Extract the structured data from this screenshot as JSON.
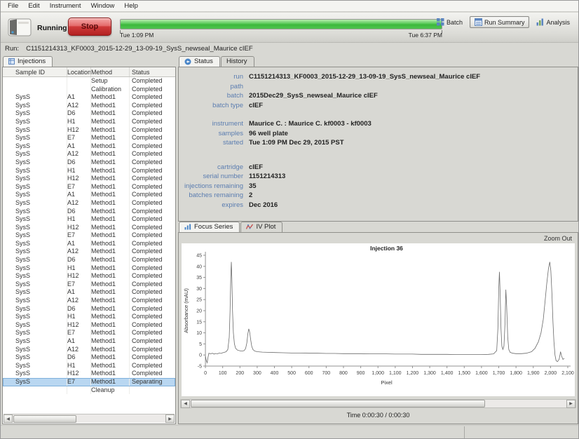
{
  "menu": {
    "items": [
      "File",
      "Edit",
      "Instrument",
      "Window",
      "Help"
    ]
  },
  "toolbar": {
    "status": "Running",
    "stop_label": "Stop",
    "progress_percent": 100,
    "progress_start": "Tue 1:09 PM",
    "progress_end": "Tue 6:37 PM",
    "buttons": [
      {
        "label": "Batch"
      },
      {
        "label": "Run Summary",
        "selected": true
      },
      {
        "label": "Analysis"
      }
    ]
  },
  "run_bar": {
    "prefix": "Run:",
    "value": "C1151214313_KF0003_2015-12-29_13-09-19_SysS_newseal_Maurice cIEF"
  },
  "injections_panel": {
    "tab_label": "Injections",
    "columns": [
      "Sample ID",
      "Location",
      "Method",
      "Status"
    ],
    "rows": [
      {
        "sample": "",
        "location": "",
        "method": "Setup",
        "status": "Completed"
      },
      {
        "sample": "",
        "location": "",
        "method": "Calibration",
        "status": "Completed"
      },
      {
        "sample": "SysS",
        "location": "A1",
        "method": "Method1",
        "status": "Completed"
      },
      {
        "sample": "SysS",
        "location": "A12",
        "method": "Method1",
        "status": "Completed"
      },
      {
        "sample": "SysS",
        "location": "D6",
        "method": "Method1",
        "status": "Completed"
      },
      {
        "sample": "SysS",
        "location": "H1",
        "method": "Method1",
        "status": "Completed"
      },
      {
        "sample": "SysS",
        "location": "H12",
        "method": "Method1",
        "status": "Completed"
      },
      {
        "sample": "SysS",
        "location": "E7",
        "method": "Method1",
        "status": "Completed"
      },
      {
        "sample": "SysS",
        "location": "A1",
        "method": "Method1",
        "status": "Completed"
      },
      {
        "sample": "SysS",
        "location": "A12",
        "method": "Method1",
        "status": "Completed"
      },
      {
        "sample": "SysS",
        "location": "D6",
        "method": "Method1",
        "status": "Completed"
      },
      {
        "sample": "SysS",
        "location": "H1",
        "method": "Method1",
        "status": "Completed"
      },
      {
        "sample": "SysS",
        "location": "H12",
        "method": "Method1",
        "status": "Completed"
      },
      {
        "sample": "SysS",
        "location": "E7",
        "method": "Method1",
        "status": "Completed"
      },
      {
        "sample": "SysS",
        "location": "A1",
        "method": "Method1",
        "status": "Completed"
      },
      {
        "sample": "SysS",
        "location": "A12",
        "method": "Method1",
        "status": "Completed"
      },
      {
        "sample": "SysS",
        "location": "D6",
        "method": "Method1",
        "status": "Completed"
      },
      {
        "sample": "SysS",
        "location": "H1",
        "method": "Method1",
        "status": "Completed"
      },
      {
        "sample": "SysS",
        "location": "H12",
        "method": "Method1",
        "status": "Completed"
      },
      {
        "sample": "SysS",
        "location": "E7",
        "method": "Method1",
        "status": "Completed"
      },
      {
        "sample": "SysS",
        "location": "A1",
        "method": "Method1",
        "status": "Completed"
      },
      {
        "sample": "SysS",
        "location": "A12",
        "method": "Method1",
        "status": "Completed"
      },
      {
        "sample": "SysS",
        "location": "D6",
        "method": "Method1",
        "status": "Completed"
      },
      {
        "sample": "SysS",
        "location": "H1",
        "method": "Method1",
        "status": "Completed"
      },
      {
        "sample": "SysS",
        "location": "H12",
        "method": "Method1",
        "status": "Completed"
      },
      {
        "sample": "SysS",
        "location": "E7",
        "method": "Method1",
        "status": "Completed"
      },
      {
        "sample": "SysS",
        "location": "A1",
        "method": "Method1",
        "status": "Completed"
      },
      {
        "sample": "SysS",
        "location": "A12",
        "method": "Method1",
        "status": "Completed"
      },
      {
        "sample": "SysS",
        "location": "D6",
        "method": "Method1",
        "status": "Completed"
      },
      {
        "sample": "SysS",
        "location": "H1",
        "method": "Method1",
        "status": "Completed"
      },
      {
        "sample": "SysS",
        "location": "H12",
        "method": "Method1",
        "status": "Completed"
      },
      {
        "sample": "SysS",
        "location": "E7",
        "method": "Method1",
        "status": "Completed"
      },
      {
        "sample": "SysS",
        "location": "A1",
        "method": "Method1",
        "status": "Completed"
      },
      {
        "sample": "SysS",
        "location": "A12",
        "method": "Method1",
        "status": "Completed"
      },
      {
        "sample": "SysS",
        "location": "D6",
        "method": "Method1",
        "status": "Completed"
      },
      {
        "sample": "SysS",
        "location": "H1",
        "method": "Method1",
        "status": "Completed"
      },
      {
        "sample": "SysS",
        "location": "H12",
        "method": "Method1",
        "status": "Completed"
      },
      {
        "sample": "SysS",
        "location": "E7",
        "method": "Method1",
        "status": "Separating",
        "selected": true
      },
      {
        "sample": "",
        "location": "",
        "method": "Cleanup",
        "status": ""
      }
    ]
  },
  "status_panel": {
    "tabs": [
      {
        "label": "Status"
      },
      {
        "label": "History"
      }
    ],
    "fields": [
      {
        "label": "run",
        "value": "C1151214313_KF0003_2015-12-29_13-09-19_SysS_newseal_Maurice cIEF"
      },
      {
        "label": "path",
        "value": ""
      },
      {
        "label": "batch",
        "value": "2015Dec29_SysS_newseal_Maurice cIEF"
      },
      {
        "label": "batch type",
        "value": "cIEF"
      },
      {
        "label": "instrument",
        "value": "Maurice C. : Maurice C. kf0003 - kf0003",
        "gap": "sm"
      },
      {
        "label": "samples",
        "value": "96 well plate"
      },
      {
        "label": "started",
        "value": "Tue 1:09 PM Dec 29, 2015 PST"
      },
      {
        "label": "cartridge",
        "value": "cIEF",
        "gap": "lg"
      },
      {
        "label": "serial number",
        "value": "1151214313"
      },
      {
        "label": "injections remaining",
        "value": "35"
      },
      {
        "label": "batches remaining",
        "value": "2"
      },
      {
        "label": "expires",
        "value": "Dec 2016"
      }
    ]
  },
  "plot_panel": {
    "tabs": [
      {
        "label": "Focus Series"
      },
      {
        "label": "IV Plot"
      }
    ],
    "zoom_out": "Zoom Out",
    "time_label": "Time 0:00:30 / 0:00:30"
  },
  "chart_data": {
    "type": "line",
    "title": "Injection 36",
    "xlabel": "Pixel",
    "ylabel": "Absorbance (mAU)",
    "xlim": [
      0,
      2100
    ],
    "ylim": [
      -5,
      45
    ],
    "x_ticks": [
      0,
      100,
      200,
      300,
      400,
      500,
      600,
      700,
      800,
      900,
      1000,
      1100,
      1200,
      1300,
      1400,
      1500,
      1600,
      1700,
      1800,
      1900,
      2000,
      2100
    ],
    "y_ticks": [
      -5,
      0,
      5,
      10,
      15,
      20,
      25,
      30,
      35,
      40,
      45
    ],
    "grid": false,
    "legend": false,
    "line_color": "#6a6a6a",
    "series": [
      {
        "name": "Injection 36",
        "points": [
          [
            0,
            -0.5
          ],
          [
            5,
            -2.5
          ],
          [
            10,
            -3.5
          ],
          [
            15,
            -1
          ],
          [
            20,
            0.8
          ],
          [
            30,
            0.5
          ],
          [
            40,
            0.8
          ],
          [
            50,
            0.4
          ],
          [
            60,
            0.7
          ],
          [
            70,
            0.5
          ],
          [
            80,
            0.9
          ],
          [
            90,
            0.7
          ],
          [
            100,
            1.0
          ],
          [
            110,
            1.2
          ],
          [
            120,
            1.5
          ],
          [
            130,
            2.5
          ],
          [
            138,
            8
          ],
          [
            143,
            20
          ],
          [
            147,
            35
          ],
          [
            150,
            42
          ],
          [
            153,
            35
          ],
          [
            157,
            20
          ],
          [
            162,
            10
          ],
          [
            168,
            5
          ],
          [
            175,
            3
          ],
          [
            185,
            2.2
          ],
          [
            195,
            2.0
          ],
          [
            205,
            1.8
          ],
          [
            215,
            1.8
          ],
          [
            225,
            2.0
          ],
          [
            233,
            3
          ],
          [
            240,
            5.5
          ],
          [
            246,
            9.5
          ],
          [
            251,
            11.8
          ],
          [
            256,
            10.5
          ],
          [
            262,
            7
          ],
          [
            268,
            4
          ],
          [
            275,
            2.5
          ],
          [
            285,
            1.8
          ],
          [
            300,
            1.5
          ],
          [
            330,
            1.3
          ],
          [
            360,
            1.2
          ],
          [
            400,
            1.1
          ],
          [
            450,
            1.0
          ],
          [
            500,
            0.9
          ],
          [
            550,
            0.9
          ],
          [
            600,
            0.8
          ],
          [
            650,
            0.8
          ],
          [
            700,
            0.7
          ],
          [
            750,
            0.7
          ],
          [
            800,
            0.6
          ],
          [
            850,
            0.6
          ],
          [
            900,
            0.6
          ],
          [
            950,
            0.5
          ],
          [
            1000,
            0.5
          ],
          [
            1050,
            0.5
          ],
          [
            1100,
            0.4
          ],
          [
            1150,
            0.4
          ],
          [
            1200,
            0.4
          ],
          [
            1250,
            0.3
          ],
          [
            1300,
            0.3
          ],
          [
            1350,
            0.3
          ],
          [
            1400,
            0.3
          ],
          [
            1450,
            0.2
          ],
          [
            1500,
            0.2
          ],
          [
            1550,
            0.2
          ],
          [
            1600,
            0.2
          ],
          [
            1640,
            0.3
          ],
          [
            1670,
            0.5
          ],
          [
            1688,
            2
          ],
          [
            1695,
            12
          ],
          [
            1700,
            30
          ],
          [
            1704,
            37.5
          ],
          [
            1708,
            28
          ],
          [
            1713,
            12
          ],
          [
            1718,
            4
          ],
          [
            1724,
            2.5
          ],
          [
            1730,
            4
          ],
          [
            1736,
            14
          ],
          [
            1741,
            29.5
          ],
          [
            1746,
            22
          ],
          [
            1752,
            8
          ],
          [
            1758,
            2.5
          ],
          [
            1766,
            1.2
          ],
          [
            1780,
            0.8
          ],
          [
            1800,
            0.6
          ],
          [
            1830,
            0.6
          ],
          [
            1860,
            0.8
          ],
          [
            1890,
            1.5
          ],
          [
            1910,
            3
          ],
          [
            1930,
            6
          ],
          [
            1945,
            10
          ],
          [
            1958,
            16
          ],
          [
            1968,
            24
          ],
          [
            1978,
            32
          ],
          [
            1988,
            39
          ],
          [
            1996,
            42
          ],
          [
            2002,
            38
          ],
          [
            2008,
            28
          ],
          [
            2014,
            15
          ],
          [
            2020,
            6
          ],
          [
            2026,
            0
          ],
          [
            2032,
            -2.5
          ],
          [
            2040,
            -3
          ],
          [
            2050,
            -2
          ],
          [
            2058,
            1.5
          ],
          [
            2064,
            -0.5
          ],
          [
            2072,
            -2
          ],
          [
            2080,
            -1.5
          ]
        ]
      }
    ]
  }
}
